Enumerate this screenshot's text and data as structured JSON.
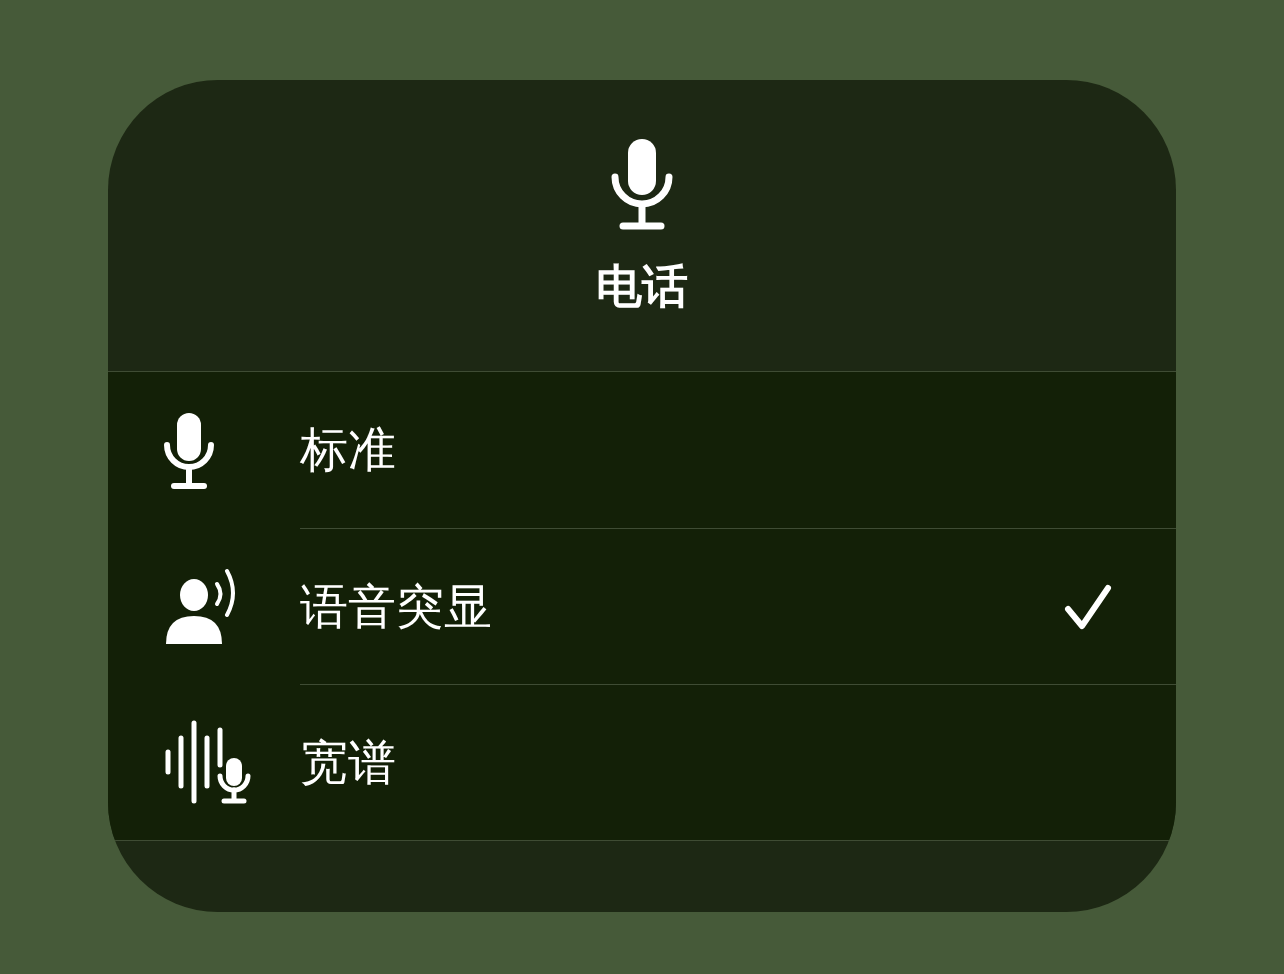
{
  "title": "电话",
  "options": [
    {
      "label": "标准",
      "selected": false
    },
    {
      "label": "语音突显",
      "selected": true
    },
    {
      "label": "宽谱",
      "selected": false
    }
  ]
}
